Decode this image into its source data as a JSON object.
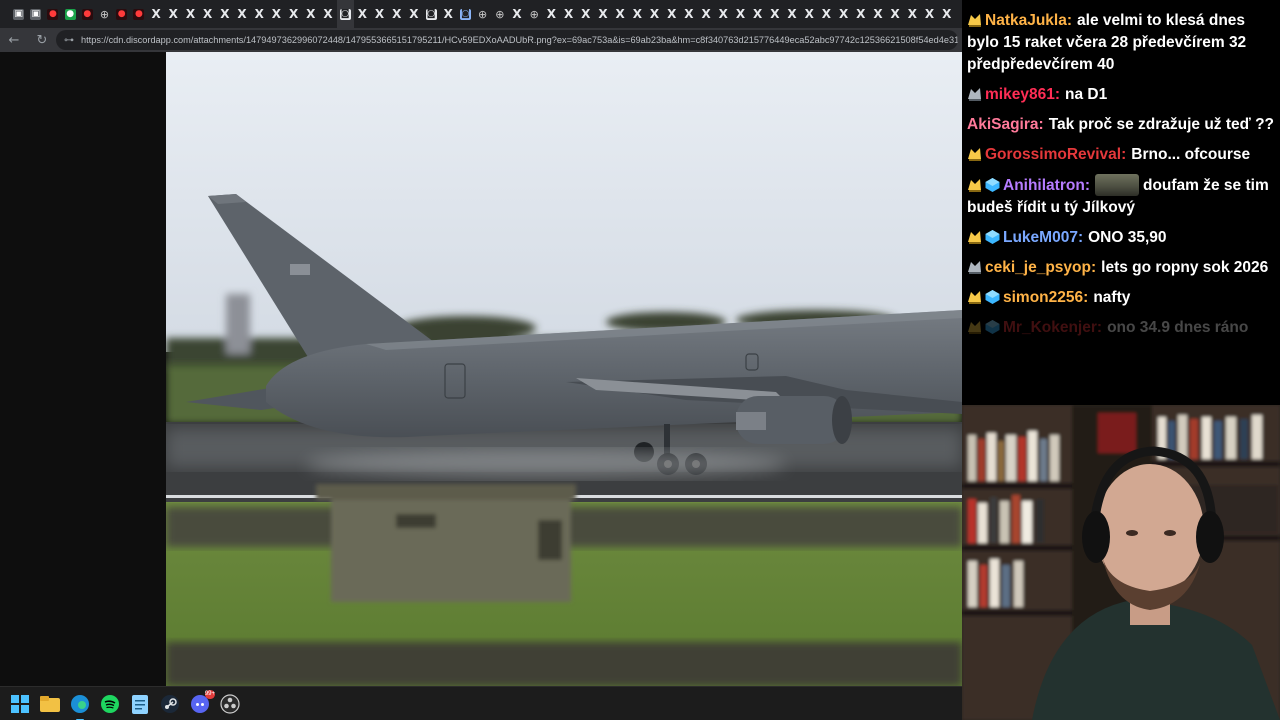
{
  "browser": {
    "tabs": [
      {
        "icon": "generic-tab-icon",
        "glyph": "▣",
        "kind": "grey"
      },
      {
        "icon": "generic-tab-icon",
        "glyph": "▣",
        "kind": "grey"
      },
      {
        "icon": "youtube-tab-icon",
        "glyph": "●",
        "kind": "red"
      },
      {
        "icon": "green-app-tab-icon",
        "glyph": "●",
        "kind": "green"
      },
      {
        "icon": "youtube-tab-icon",
        "glyph": "●",
        "kind": "red"
      },
      {
        "icon": "globe-tab-icon",
        "glyph": "⊕",
        "kind": "globe"
      },
      {
        "icon": "youtube-tab-icon",
        "glyph": "●",
        "kind": "red"
      },
      {
        "icon": "youtube-tab-icon",
        "glyph": "●",
        "kind": "red"
      },
      {
        "icon": "x-tab-icon",
        "glyph": "X",
        "kind": "x"
      },
      {
        "icon": "x-tab-icon",
        "glyph": "X",
        "kind": "x"
      },
      {
        "icon": "x-tab-icon",
        "glyph": "X",
        "kind": "x"
      },
      {
        "icon": "x-tab-icon",
        "glyph": "X",
        "kind": "x"
      },
      {
        "icon": "x-tab-icon",
        "glyph": "X",
        "kind": "x"
      },
      {
        "icon": "x-tab-icon",
        "glyph": "X",
        "kind": "x"
      },
      {
        "icon": "x-tab-icon",
        "glyph": "X",
        "kind": "x"
      },
      {
        "icon": "x-tab-icon",
        "glyph": "X",
        "kind": "x"
      },
      {
        "icon": "x-tab-icon",
        "glyph": "X",
        "kind": "x"
      },
      {
        "icon": "x-tab-icon",
        "glyph": "X",
        "kind": "x"
      },
      {
        "icon": "x-tab-icon",
        "glyph": "X",
        "kind": "x"
      },
      {
        "icon": "discord-tab-icon",
        "glyph": "◙",
        "kind": "white",
        "active": true
      },
      {
        "icon": "x-tab-icon",
        "glyph": "X",
        "kind": "x"
      },
      {
        "icon": "x-tab-icon",
        "glyph": "X",
        "kind": "x"
      },
      {
        "icon": "x-tab-icon",
        "glyph": "X",
        "kind": "x"
      },
      {
        "icon": "x-tab-icon",
        "glyph": "X",
        "kind": "x"
      },
      {
        "icon": "discord-tab-icon",
        "glyph": "◙",
        "kind": "white"
      },
      {
        "icon": "x-tab-icon",
        "glyph": "X",
        "kind": "x"
      },
      {
        "icon": "discord-tab-icon",
        "glyph": "◙",
        "kind": "blue"
      },
      {
        "icon": "globe-tab-icon",
        "glyph": "⊕",
        "kind": "globe"
      },
      {
        "icon": "globe-tab-icon",
        "glyph": "⊕",
        "kind": "globe"
      },
      {
        "icon": "x-tab-icon",
        "glyph": "X",
        "kind": "x"
      },
      {
        "icon": "globe-tab-icon",
        "glyph": "⊕",
        "kind": "globe"
      },
      {
        "icon": "x-tab-icon",
        "glyph": "X",
        "kind": "x"
      },
      {
        "icon": "x-tab-icon",
        "glyph": "X",
        "kind": "x"
      },
      {
        "icon": "x-tab-icon",
        "glyph": "X",
        "kind": "x"
      },
      {
        "icon": "x-tab-icon",
        "glyph": "X",
        "kind": "x"
      },
      {
        "icon": "x-tab-icon",
        "glyph": "X",
        "kind": "x"
      },
      {
        "icon": "x-tab-icon",
        "glyph": "X",
        "kind": "x"
      },
      {
        "icon": "x-tab-icon",
        "glyph": "X",
        "kind": "x"
      },
      {
        "icon": "x-tab-icon",
        "glyph": "X",
        "kind": "x"
      },
      {
        "icon": "x-tab-icon",
        "glyph": "X",
        "kind": "x"
      },
      {
        "icon": "x-tab-icon",
        "glyph": "X",
        "kind": "x"
      },
      {
        "icon": "x-tab-icon",
        "glyph": "X",
        "kind": "x"
      },
      {
        "icon": "x-tab-icon",
        "glyph": "X",
        "kind": "x"
      },
      {
        "icon": "x-tab-icon",
        "glyph": "X",
        "kind": "x"
      },
      {
        "icon": "x-tab-icon",
        "glyph": "X",
        "kind": "x"
      },
      {
        "icon": "x-tab-icon",
        "glyph": "X",
        "kind": "x"
      },
      {
        "icon": "x-tab-icon",
        "glyph": "X",
        "kind": "x"
      },
      {
        "icon": "x-tab-icon",
        "glyph": "X",
        "kind": "x"
      },
      {
        "icon": "x-tab-icon",
        "glyph": "X",
        "kind": "x"
      },
      {
        "icon": "x-tab-icon",
        "glyph": "X",
        "kind": "x"
      },
      {
        "icon": "x-tab-icon",
        "glyph": "X",
        "kind": "x"
      },
      {
        "icon": "x-tab-icon",
        "glyph": "X",
        "kind": "x"
      },
      {
        "icon": "x-tab-icon",
        "glyph": "X",
        "kind": "x"
      },
      {
        "icon": "x-tab-icon",
        "glyph": "X",
        "kind": "x"
      },
      {
        "icon": "x-tab-icon",
        "glyph": "X",
        "kind": "x"
      }
    ],
    "nav": {
      "back_glyph": "←",
      "reload_glyph": "↻"
    },
    "address": {
      "site_info_glyph": "⊶",
      "url": "https://cdn.discordapp.com/attachments/1479497362996072448/1479553665151795211/HCv59EDXoAADUbR.png?ex=69ac753a&is=69ab23ba&hm=c8f340763d215776449eca52abc97742c12536621508f54ed4e31d2..."
    }
  },
  "taskbar": {
    "items": [
      {
        "name": "windows-start-icon"
      },
      {
        "name": "file-explorer-icon"
      },
      {
        "name": "edge-browser-icon",
        "active": true
      },
      {
        "name": "spotify-icon"
      },
      {
        "name": "notepad-icon"
      },
      {
        "name": "steam-icon"
      },
      {
        "name": "discord-taskbar-icon",
        "badge": "99+"
      },
      {
        "name": "obs-icon"
      }
    ]
  },
  "chat": {
    "messages": [
      {
        "badges": [
          "sub-badge"
        ],
        "user": "NatkaJukla",
        "color": "#ffb347",
        "text": "ale velmi to klesá dnes bylo 15 raket včera 28 předevčírem 32 předpředevčírem 40"
      },
      {
        "badges": [
          "sub-badge-grey"
        ],
        "user": "mikey861",
        "color": "#ff2d55",
        "text": "na D1"
      },
      {
        "badges": [],
        "user": "AkiSagira",
        "color": "#ff7a9a",
        "text": "Tak proč se zdražuje už teď ??"
      },
      {
        "badges": [
          "sub-badge"
        ],
        "user": "GorossimoRevival",
        "color": "#e5383b",
        "text": "Brno... ofcourse"
      },
      {
        "badges": [
          "sub-badge",
          "gift-badge"
        ],
        "user": "Anihilatron",
        "color": "#b67cff",
        "emote": true,
        "text": "doufam že se tim budeš řídit u tý Jílkový"
      },
      {
        "badges": [
          "sub-badge",
          "gift-badge"
        ],
        "user": "LukeM007",
        "color": "#7aa8ff",
        "text": "ONO 35,90"
      },
      {
        "badges": [
          "sub-badge-grey"
        ],
        "user": "ceki_je_psyop",
        "color": "#ffb347",
        "text": "lets go ropny sok 2026"
      },
      {
        "badges": [
          "sub-badge",
          "gift-badge"
        ],
        "user": "simon2256",
        "color": "#ffb347",
        "text": "nafty"
      },
      {
        "badges": [
          "sub-badge",
          "gift-badge"
        ],
        "user": "Mr_Kokenjer",
        "color": "#e5383b",
        "text": "ono 34.9 dnes ráno",
        "faded": true
      }
    ]
  },
  "colors": {
    "chrome_dark": "#202124",
    "chrome_mid": "#35363a",
    "viewer_bg": "#0e0e0e",
    "chat_bg": "#000000",
    "taskbar_bg": "#1c1c1c",
    "active_indicator": "#4cc2ff"
  }
}
